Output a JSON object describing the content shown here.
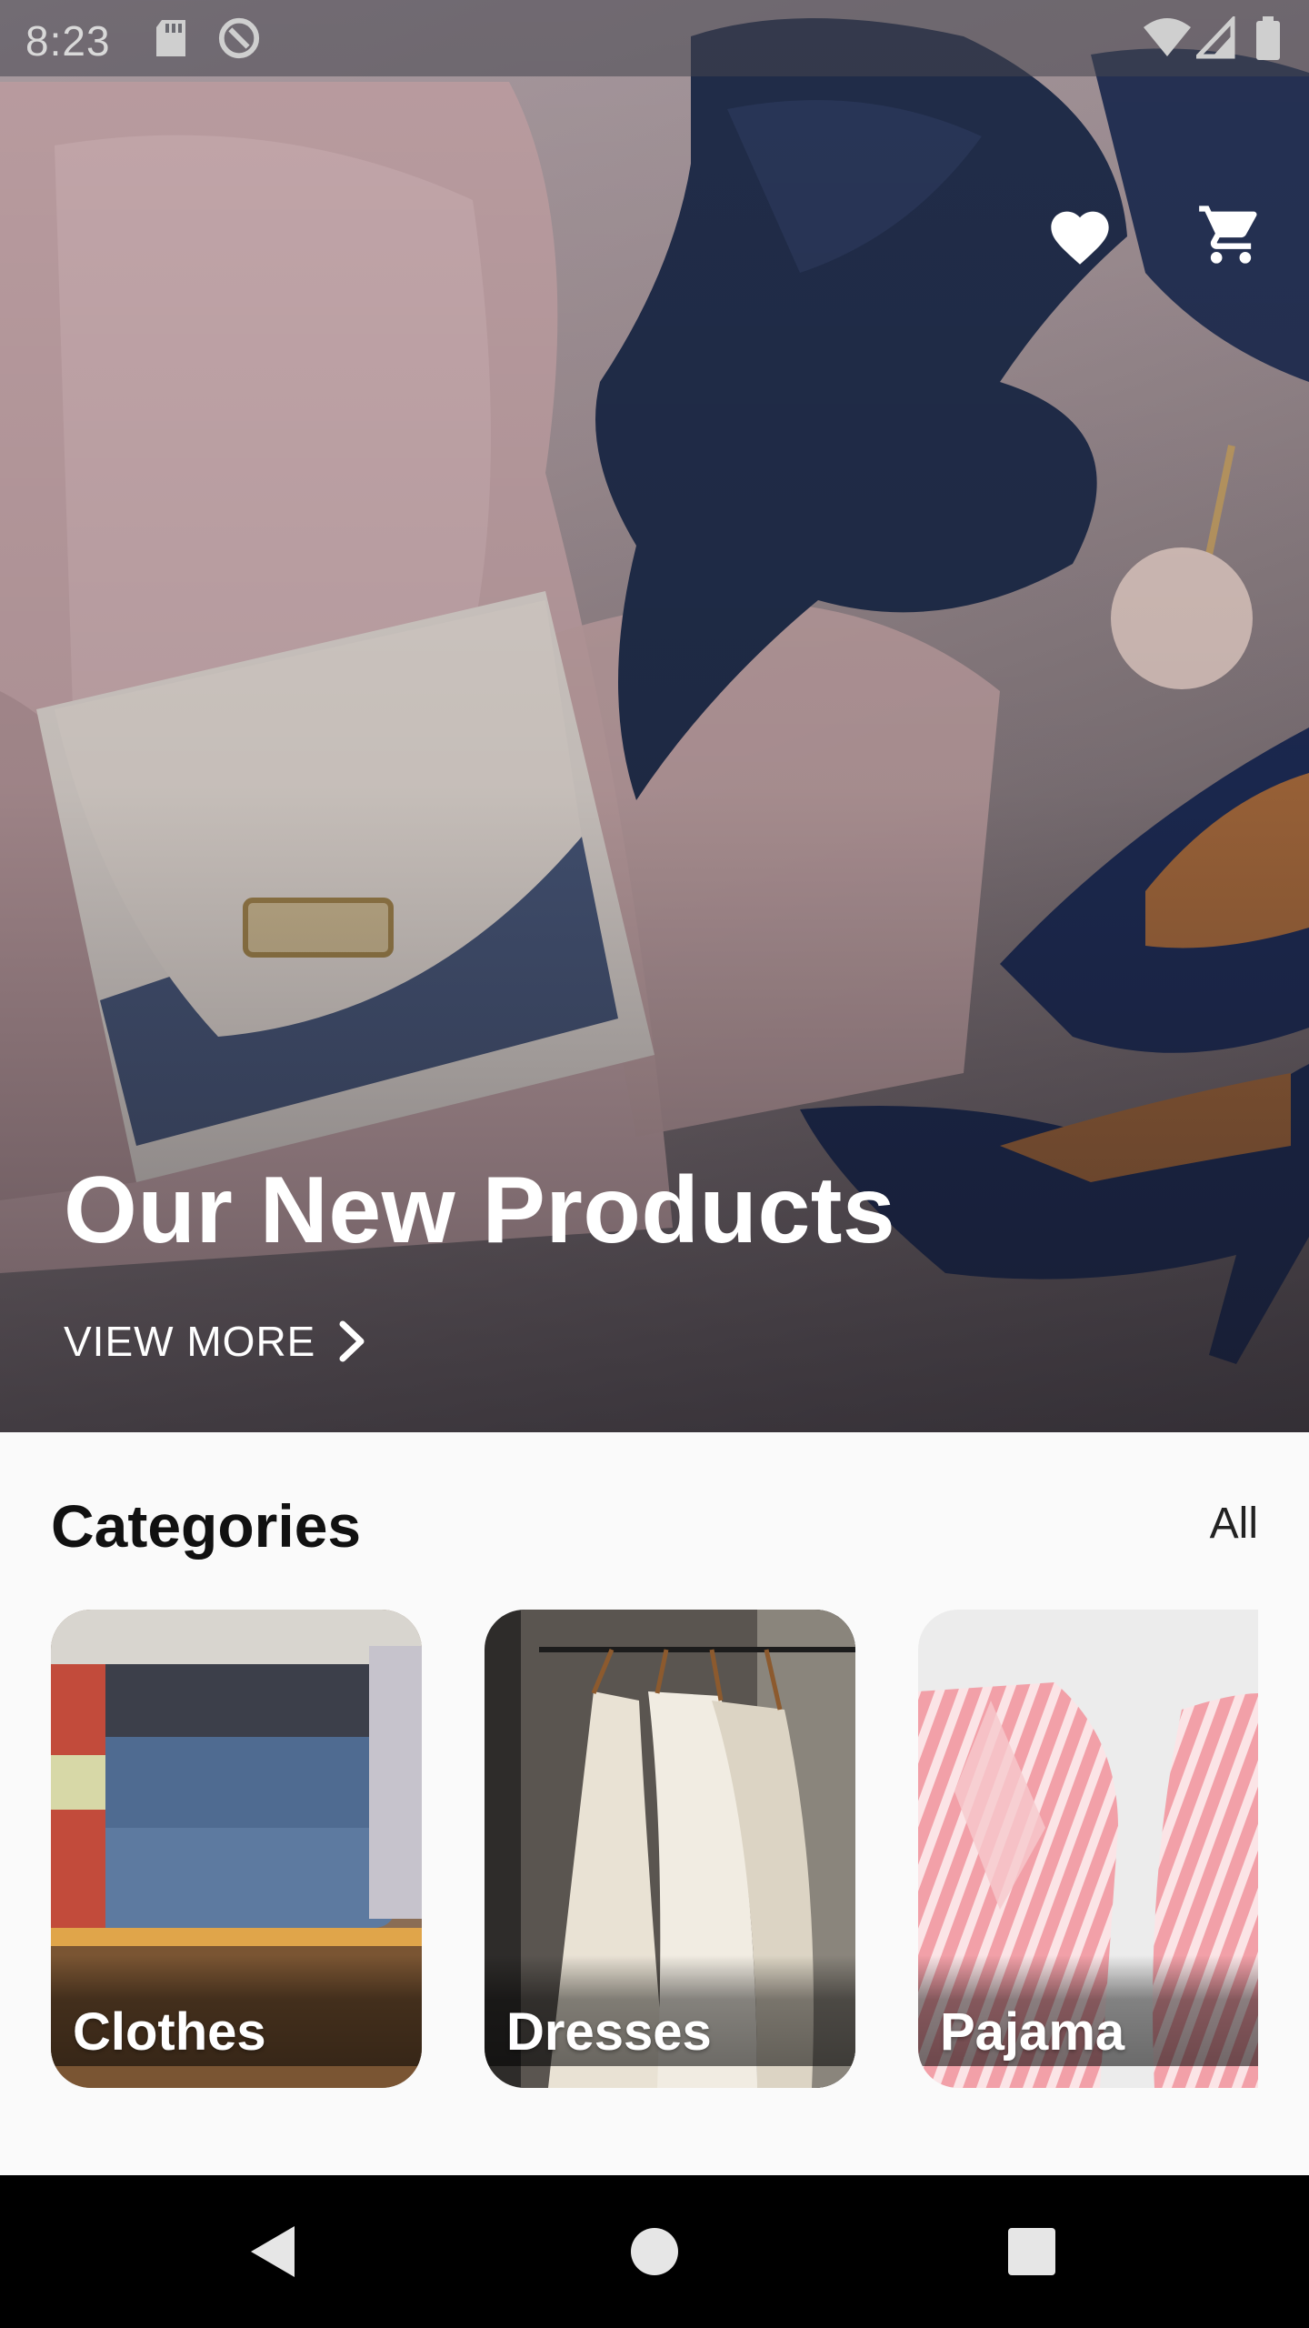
{
  "status_bar": {
    "time": "8:23",
    "left_icons": [
      "sd-card-icon",
      "sync-icon"
    ],
    "right_icons": [
      "wifi-icon",
      "signal-icon",
      "battery-icon"
    ]
  },
  "hero": {
    "title": "Our New Products",
    "cta_label": "VIEW MORE",
    "actions": [
      "heart-icon",
      "cart-icon"
    ]
  },
  "categories": {
    "title": "Categories",
    "all_label": "All",
    "items": [
      {
        "label": "Clothes"
      },
      {
        "label": "Dresses"
      },
      {
        "label": "Pajama"
      }
    ]
  },
  "nav_bar": {
    "buttons": [
      "back-icon",
      "home-icon",
      "recents-icon"
    ]
  },
  "colors": {
    "hero_text": "#ffffff",
    "page_background": "#fafafa",
    "title_text": "#111111",
    "nav_background": "#000000"
  }
}
